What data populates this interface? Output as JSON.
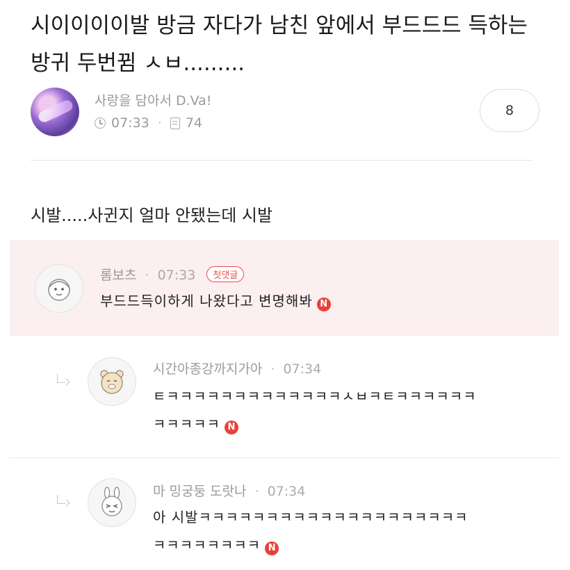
{
  "post": {
    "title": "시이이이이발 방금 자다가 남친 앞에서 부드드드 득하는 방귀 두번뀜 ㅅㅂ.........",
    "author": "사랑을 담아서 D.Va!",
    "time": "07:33",
    "views": "74",
    "comment_count": "8",
    "body": "시발.....사귄지 얼마 안됐는데 시발"
  },
  "comments": [
    {
      "nickname": "롬보츠",
      "time": "07:33",
      "badge": "첫댓글",
      "text": "부드드득이하게 나왔다고 변명해봐",
      "new_badge": "N"
    }
  ],
  "replies": [
    {
      "nickname": "시간아종강까지가아",
      "time": "07:34",
      "text_line1": "ㅌㅋㅋㅋㅋㅋㅋㅋㅋㅋㅋㅋㅋㅋㅅㅂㅋㅌㅋㅋㅋㅋㅋㅋ",
      "text_line2": "ㅋㅋㅋㅋㅋ",
      "new_badge": "N"
    },
    {
      "nickname": "마 밍궁둥 도랏나",
      "time": "07:34",
      "text_line1": "아 시발ㅋㅋㅋㅋㅋㅋㅋㅋㅋㅋㅋㅋㅋㅋㅋㅋㅋㅋㅋㅋ",
      "text_line2": "ㅋㅋㅋㅋㅋㅋㅋㅋ",
      "new_badge": "N"
    }
  ],
  "colors": {
    "highlight_bg": "#fcefef",
    "badge_red": "#e4504b",
    "meta_gray": "#9a9a9a"
  }
}
